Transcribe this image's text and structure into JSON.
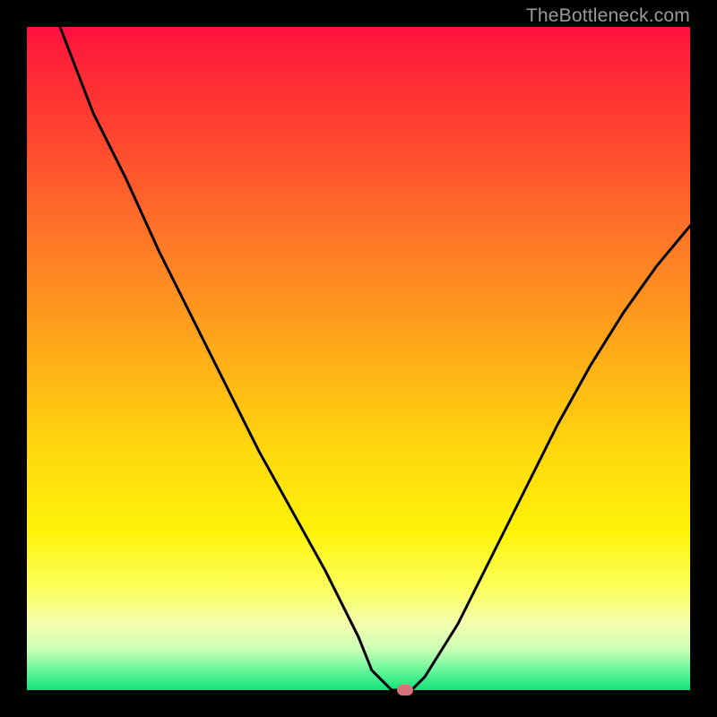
{
  "watermark": "TheBottleneck.com",
  "chart_data": {
    "type": "line",
    "title": "",
    "xlabel": "",
    "ylabel": "",
    "xlim": [
      0,
      100
    ],
    "ylim": [
      0,
      100
    ],
    "background_gradient": [
      "#ff1040",
      "#ff6a2a",
      "#ffd80e",
      "#fcff60",
      "#12e27a"
    ],
    "series": [
      {
        "name": "bottleneck-curve",
        "x": [
          5,
          10,
          15,
          20,
          25,
          30,
          35,
          40,
          45,
          50,
          52,
          55,
          58,
          60,
          65,
          70,
          75,
          80,
          85,
          90,
          95,
          100
        ],
        "y": [
          100,
          87,
          77,
          66,
          56,
          46,
          36,
          27,
          18,
          8,
          3,
          0,
          0,
          2,
          10,
          20,
          30,
          40,
          49,
          57,
          64,
          70
        ]
      }
    ],
    "marker": {
      "x": 57,
      "y": 0,
      "color": "#d6727a"
    },
    "grid": false,
    "legend": false
  }
}
